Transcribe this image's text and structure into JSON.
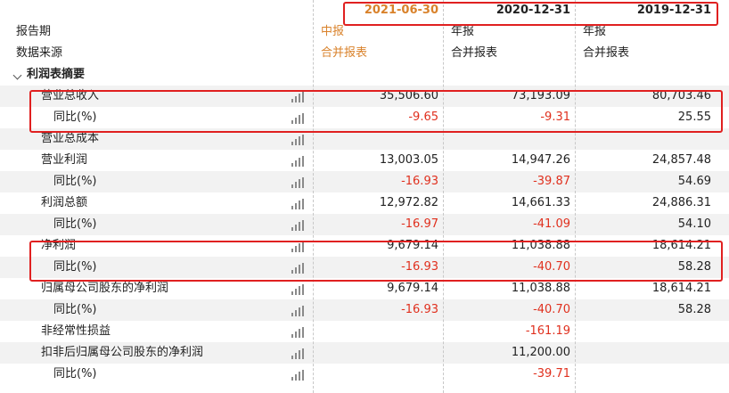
{
  "header": {
    "col1": "2021-06-30",
    "col2": "2020-12-31",
    "col3": "2019-12-31"
  },
  "meta": {
    "report_period_label": "报告期",
    "report_period_values": [
      "中报",
      "年报",
      "年报"
    ],
    "data_source_label": "数据来源",
    "data_source_values": [
      "合并报表",
      "合并报表",
      "合并报表"
    ]
  },
  "section": {
    "label": "利润表摘要"
  },
  "rows": [
    {
      "label": "营业总收入",
      "values": [
        "35,506.60",
        "73,193.09",
        "80,703.46"
      ],
      "neg": [
        false,
        false,
        false
      ],
      "indent": 1
    },
    {
      "label": "同比(%)",
      "values": [
        "-9.65",
        "-9.31",
        "25.55"
      ],
      "neg": [
        true,
        true,
        false
      ],
      "indent": 2
    },
    {
      "label": "营业总成本",
      "values": [
        "",
        "",
        ""
      ],
      "neg": [
        false,
        false,
        false
      ],
      "indent": 1
    },
    {
      "label": "营业利润",
      "values": [
        "13,003.05",
        "14,947.26",
        "24,857.48"
      ],
      "neg": [
        false,
        false,
        false
      ],
      "indent": 1
    },
    {
      "label": "同比(%)",
      "values": [
        "-16.93",
        "-39.87",
        "54.69"
      ],
      "neg": [
        true,
        true,
        false
      ],
      "indent": 2
    },
    {
      "label": "利润总额",
      "values": [
        "12,972.82",
        "14,661.33",
        "24,886.31"
      ],
      "neg": [
        false,
        false,
        false
      ],
      "indent": 1
    },
    {
      "label": "同比(%)",
      "values": [
        "-16.97",
        "-41.09",
        "54.10"
      ],
      "neg": [
        true,
        true,
        false
      ],
      "indent": 2
    },
    {
      "label": "净利润",
      "values": [
        "9,679.14",
        "11,038.88",
        "18,614.21"
      ],
      "neg": [
        false,
        false,
        false
      ],
      "indent": 1
    },
    {
      "label": "同比(%)",
      "values": [
        "-16.93",
        "-40.70",
        "58.28"
      ],
      "neg": [
        true,
        true,
        false
      ],
      "indent": 2
    },
    {
      "label": "归属母公司股东的净利润",
      "values": [
        "9,679.14",
        "11,038.88",
        "18,614.21"
      ],
      "neg": [
        false,
        false,
        false
      ],
      "indent": 1
    },
    {
      "label": "同比(%)",
      "values": [
        "-16.93",
        "-40.70",
        "58.28"
      ],
      "neg": [
        true,
        true,
        false
      ],
      "indent": 2
    },
    {
      "label": "非经常性损益",
      "values": [
        "",
        "-161.19",
        ""
      ],
      "neg": [
        false,
        true,
        false
      ],
      "indent": 1
    },
    {
      "label": "扣非后归属母公司股东的净利润",
      "values": [
        "",
        "11,200.00",
        ""
      ],
      "neg": [
        false,
        false,
        false
      ],
      "indent": 1
    },
    {
      "label": "同比(%)",
      "values": [
        "",
        "-39.71",
        ""
      ],
      "neg": [
        false,
        true,
        false
      ],
      "indent": 2
    }
  ],
  "colors": {
    "negative": "#e0301e",
    "highlight": "#d9822b",
    "box": "#e02020"
  },
  "icons": {
    "row_chart": "bar-chart-icon",
    "section_toggle": "chevron-down-icon"
  }
}
